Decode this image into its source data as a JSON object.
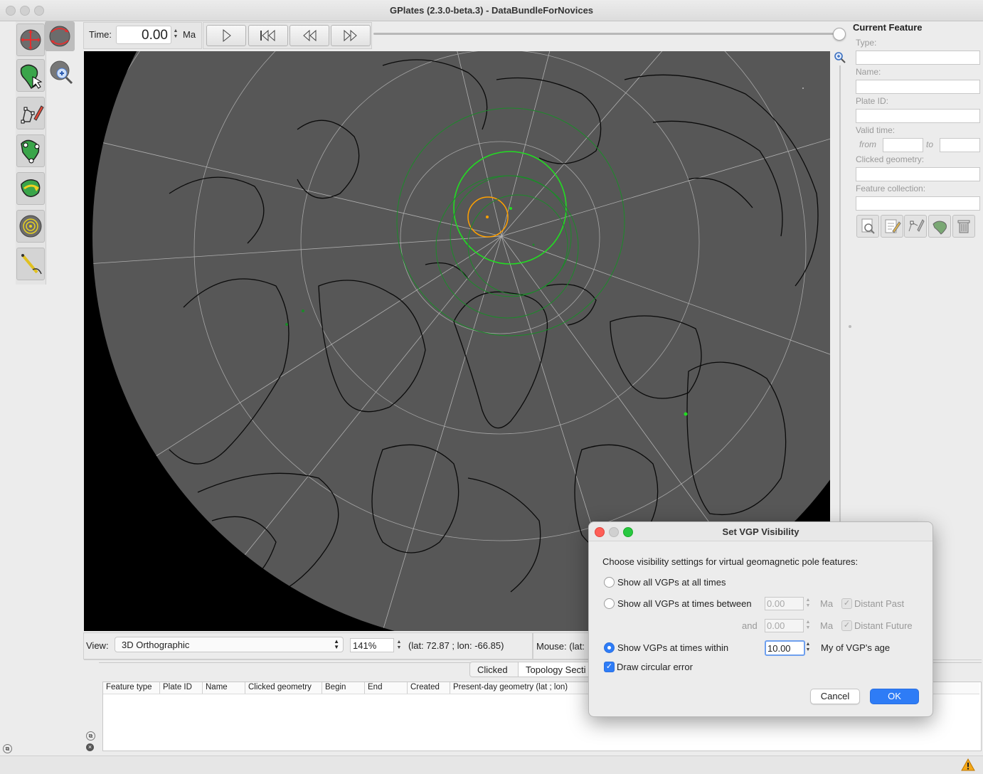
{
  "window": {
    "title": "GPlates (2.3.0-beta.3) - DataBundleForNovices"
  },
  "left_tools": {
    "items": [
      "globe-drag-icon",
      "globe-rotate-icon",
      "zoom-icon",
      "choose-feature-icon",
      "digitise-icon",
      "modify-geometry-icon",
      "move-pole-icon",
      "small-circle-icon",
      "measure-icon"
    ]
  },
  "toolbar": {
    "time_label": "Time:",
    "time_value": "0.00",
    "time_unit": "Ma",
    "slider_value": 1.0
  },
  "globe": {
    "view_label": "View:",
    "projection": "3D Orthographic",
    "zoom": "141%",
    "camera_coords": "(lat: 72.87 ; lon: -66.85)",
    "mouse_label": "Mouse: (lat:"
  },
  "current_feature": {
    "heading": "Current Feature",
    "type_label": "Type:",
    "name_label": "Name:",
    "plate_id_label": "Plate ID:",
    "valid_time_label": "Valid time:",
    "from_label": "from",
    "to_label": "to",
    "clicked_geometry_label": "Clicked geometry:",
    "feature_collection_label": "Feature collection:"
  },
  "bottom_panel": {
    "tabs": [
      "Clicked",
      "Topology Secti"
    ],
    "columns": [
      "Feature type",
      "Plate ID",
      "Name",
      "Clicked geometry",
      "Begin",
      "End",
      "Created",
      "Present-day geometry (lat ; lon)"
    ]
  },
  "dialog": {
    "title": "Set VGP Visibility",
    "prompt": "Choose visibility settings for virtual geomagnetic pole features:",
    "option_all": "Show all VGPs at all times",
    "option_between": "Show all VGPs at times between",
    "between_from": "0.00",
    "between_from_unit": "Ma",
    "distant_past": "Distant Past",
    "and_label": "and",
    "between_to": "0.00",
    "between_to_unit": "Ma",
    "distant_future": "Distant Future",
    "option_within": "Show VGPs at times within",
    "within_value": "10.00",
    "within_unit": "My of VGP's age",
    "draw_error": "Draw circular error",
    "cancel": "Cancel",
    "ok": "OK",
    "accent_color": "#2e7cf6"
  }
}
